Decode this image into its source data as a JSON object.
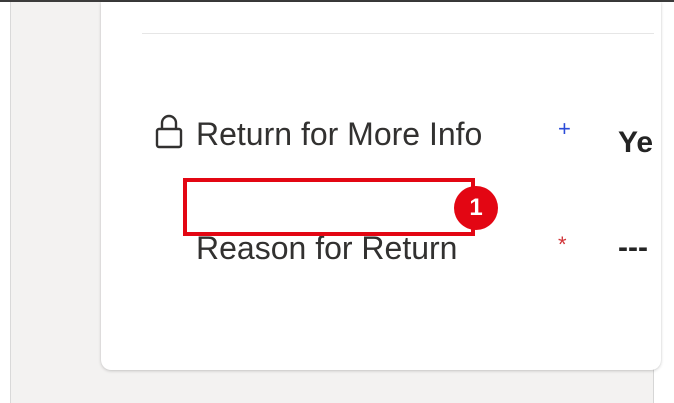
{
  "form": {
    "fields": [
      {
        "label": "Return for More Info",
        "required_marker": "+",
        "value": "Ye",
        "locked": true
      },
      {
        "label": "Reason for Return",
        "required_marker": "*",
        "value": "---",
        "locked": false
      }
    ]
  },
  "annotation": {
    "badge_text": "1"
  },
  "colors": {
    "highlight": "#e30613",
    "required_blue": "#2b4bd8",
    "required_red": "#d13438"
  }
}
